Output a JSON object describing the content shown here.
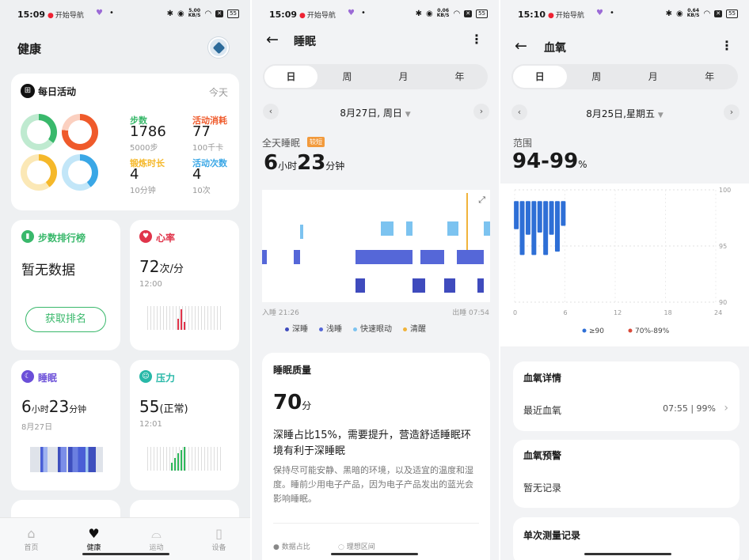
{
  "status": [
    {
      "time": "15:09",
      "nav": "开始导航",
      "speed_top": "5.00",
      "speed_bot": "KB/S",
      "battery": "55"
    },
    {
      "time": "15:09",
      "nav": "开始导航",
      "speed_top": "0.06",
      "speed_bot": "KB/S",
      "battery": "55"
    },
    {
      "time": "15:10",
      "nav": "开始导航",
      "speed_top": "0.64",
      "speed_bot": "KB/S",
      "battery": "55"
    }
  ],
  "health": {
    "title": "健康",
    "daily": {
      "title": "每日活动",
      "today": "今天",
      "steps_label": "步数",
      "steps_value": "1786",
      "steps_goal": "5000步",
      "cal_label": "活动消耗",
      "cal_value": "77",
      "cal_goal": "100千卡",
      "ex_label": "锻炼时长",
      "ex_value": "4",
      "ex_goal": "10分钟",
      "act_label": "活动次数",
      "act_value": "4",
      "act_goal": "10次",
      "colors": {
        "steps": "#39b86b",
        "cal": "#ef5a2b",
        "ex": "#f5b82a",
        "act": "#3aa7e6"
      }
    },
    "rank": {
      "title": "步数排行榜",
      "empty": "暂无数据",
      "button": "获取排名"
    },
    "heart": {
      "title": "心率",
      "value": "72",
      "unit": "次/分",
      "time": "12:00"
    },
    "sleep": {
      "title": "睡眠",
      "h": "6",
      "h_unit": "小时",
      "m": "23",
      "m_unit": "分钟",
      "date": "8月27日"
    },
    "stress": {
      "title": "压力",
      "value": "55",
      "state": "(正常)",
      "time": "12:01"
    },
    "tabs": [
      {
        "label": "首页",
        "icon": "home-icon"
      },
      {
        "label": "健康",
        "icon": "heart-icon"
      },
      {
        "label": "运动",
        "icon": "shoe-icon"
      },
      {
        "label": "设备",
        "icon": "watch-icon"
      }
    ]
  },
  "sleep_page": {
    "title": "睡眠",
    "periods": [
      "日",
      "周",
      "月",
      "年"
    ],
    "date": "8月27日, 周日",
    "all_day": "全天睡眠",
    "badge": "较短",
    "h": "6",
    "h_unit": "小时",
    "m": "23",
    "m_unit": "分钟",
    "start": "入睡 21:26",
    "end": "出睡 07:54",
    "legend": [
      {
        "label": "深睡",
        "color": "#3f4bbd"
      },
      {
        "label": "浅睡",
        "color": "#5567d8"
      },
      {
        "label": "快速眼动",
        "color": "#7cc3f0"
      },
      {
        "label": "清醒",
        "color": "#f0b33a"
      }
    ],
    "quality_title": "睡眠质量",
    "score": "70",
    "score_unit": "分",
    "advice_main": "深睡占比15%，需要提升，营造舒适睡眠环境有利于深睡眠",
    "advice_sub": "保持尽可能安静、黑暗的环境，以及适宜的温度和湿度。睡前少用电子产品，因为电子产品发出的蓝光会影响睡眠。",
    "foot_a": "数据占比",
    "foot_b": "理想区间"
  },
  "spo2_page": {
    "title": "血氧",
    "periods": [
      "日",
      "周",
      "月",
      "年"
    ],
    "date": "8月25日,星期五",
    "range_label": "范围",
    "range_value": "94-99",
    "range_unit": "%",
    "chart_data": {
      "type": "bar",
      "xlabel": "",
      "ylabel": "",
      "x_ticks": [
        "0",
        "6",
        "12",
        "18",
        "24"
      ],
      "y_ticks": [
        "100",
        "95",
        "90"
      ],
      "ylim": [
        90,
        100
      ],
      "series": [
        {
          "name": "≥90",
          "color": "#2e6fd6",
          "bars": [
            {
              "x": 0.2,
              "hi": 99,
              "lo": 96.5
            },
            {
              "x": 0.9,
              "hi": 99,
              "lo": 94.2
            },
            {
              "x": 1.6,
              "hi": 99,
              "lo": 96.0
            },
            {
              "x": 2.3,
              "hi": 99,
              "lo": 94.2
            },
            {
              "x": 3.0,
              "hi": 99,
              "lo": 96.2
            },
            {
              "x": 3.7,
              "hi": 99,
              "lo": 94.2
            },
            {
              "x": 4.4,
              "hi": 99,
              "lo": 96.0
            },
            {
              "x": 5.1,
              "hi": 99,
              "lo": 94.5
            },
            {
              "x": 5.8,
              "hi": 99,
              "lo": 96.8
            }
          ]
        },
        {
          "name": "70%-89%",
          "color": "#d94a3a",
          "bars": []
        }
      ]
    },
    "detail_title": "血氧详情",
    "recent_label": "最近血氧",
    "recent_value": "07:55 | 99%",
    "warn_title": "血氧预警",
    "warn_value": "暂无记录",
    "single_title": "单次测量记录"
  }
}
